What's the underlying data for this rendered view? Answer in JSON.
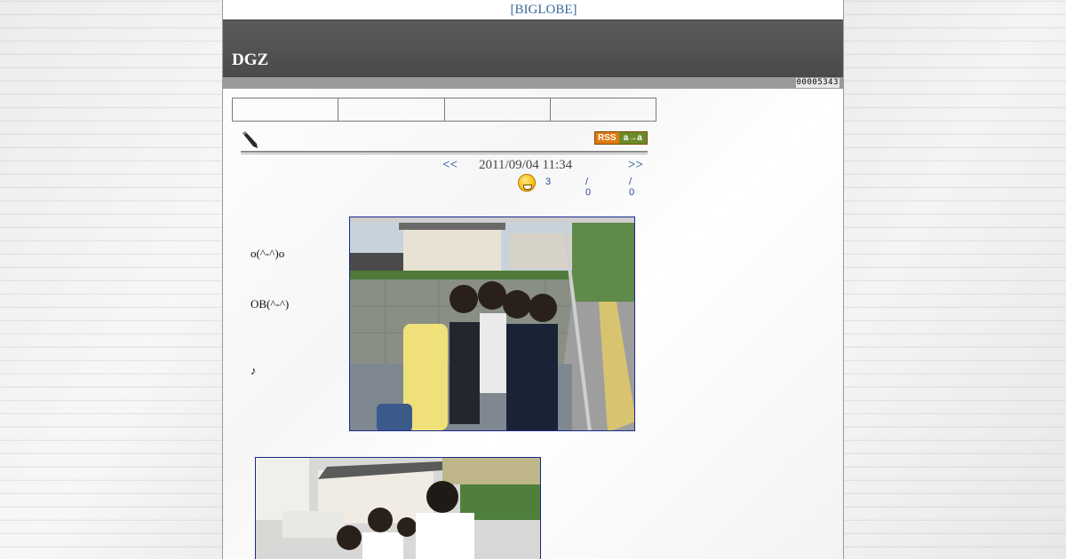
{
  "topbar": {
    "link": "[BIGLOBE]"
  },
  "header": {
    "title": "DGZ",
    "counter": "00005343"
  },
  "nav_cells": [
    "",
    "",
    "",
    ""
  ],
  "rss": {
    "left": "RSS",
    "right": "a→a"
  },
  "post": {
    "prev": "<<",
    "date": "2011/09/04 11:34",
    "next": ">>",
    "stats": {
      "s1": "3",
      "s2": "/ 0",
      "s3": "/ 0"
    },
    "lines": [
      "o(^-^)o",
      "OB(^-^)",
      "♪"
    ]
  },
  "icons": [
    "pen-icon",
    "rss-badge-icon",
    "smiley-icon"
  ],
  "colors": {
    "header": "#4f4f4f",
    "link": "#3a6a9a",
    "photo_border": "#1a2a8a"
  }
}
